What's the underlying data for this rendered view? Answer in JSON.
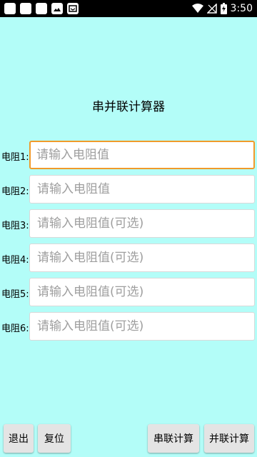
{
  "statusbar": {
    "time": "3:50",
    "icons": [
      "app-icon",
      "app-icon",
      "app-icon",
      "image-icon",
      "inbox-icon",
      "wifi-icon",
      "signal-icon",
      "battery-icon"
    ]
  },
  "title": "串并联计算器",
  "rows": [
    {
      "label": "电阻1:",
      "placeholder": "请输入电阻值"
    },
    {
      "label": "电阻2:",
      "placeholder": "请输入电阻值"
    },
    {
      "label": "电阻3:",
      "placeholder": "请输入电阻值(可选)"
    },
    {
      "label": "电阻4:",
      "placeholder": "请输入电阻值(可选)"
    },
    {
      "label": "电阻5:",
      "placeholder": "请输入电阻值(可选)"
    },
    {
      "label": "电阻6:",
      "placeholder": "请输入电阻值(可选)"
    }
  ],
  "buttons": {
    "exit": "退出",
    "reset": "复位",
    "series": "串联计算",
    "parallel": "并联计算"
  },
  "colors": {
    "background": "#b3fdf8",
    "focus_border": "#f09a2a"
  }
}
